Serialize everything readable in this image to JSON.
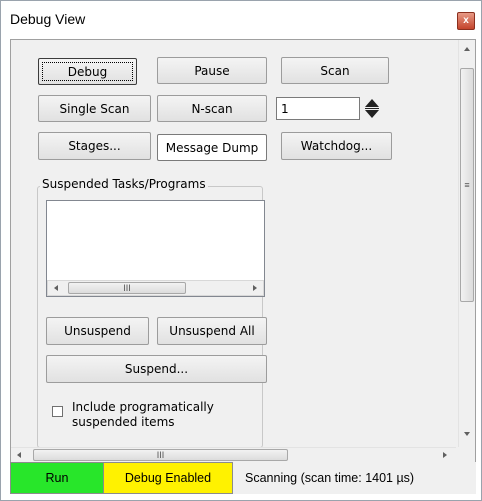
{
  "window": {
    "title": "Debug View",
    "close_glyph": "x"
  },
  "buttons": {
    "debug": "Debug",
    "pause": "Pause",
    "scan": "Scan",
    "single_scan": "Single Scan",
    "n_scan": "N-scan",
    "stages": "Stages...",
    "message_dump": "Message Dump",
    "watchdog": "Watchdog..."
  },
  "n_scan_count": "1",
  "suspended": {
    "group_label": "Suspended Tasks/Programs",
    "items": [],
    "unsuspend": "Unsuspend",
    "unsuspend_all": "Unsuspend All",
    "suspend": "Suspend...",
    "include_label_line1": "Include programatically",
    "include_label_line2": "suspended items",
    "include_checked": false,
    "list_thumb_grip": "III"
  },
  "scrollbar": {
    "h_thumb_grip": "III",
    "v_thumb_grip": "≡"
  },
  "status": {
    "run": "Run",
    "debug_enabled": "Debug Enabled",
    "scanning": "Scanning (scan time: 1401 µs)",
    "run_color": "#28e62a",
    "debug_color": "#fff200"
  }
}
